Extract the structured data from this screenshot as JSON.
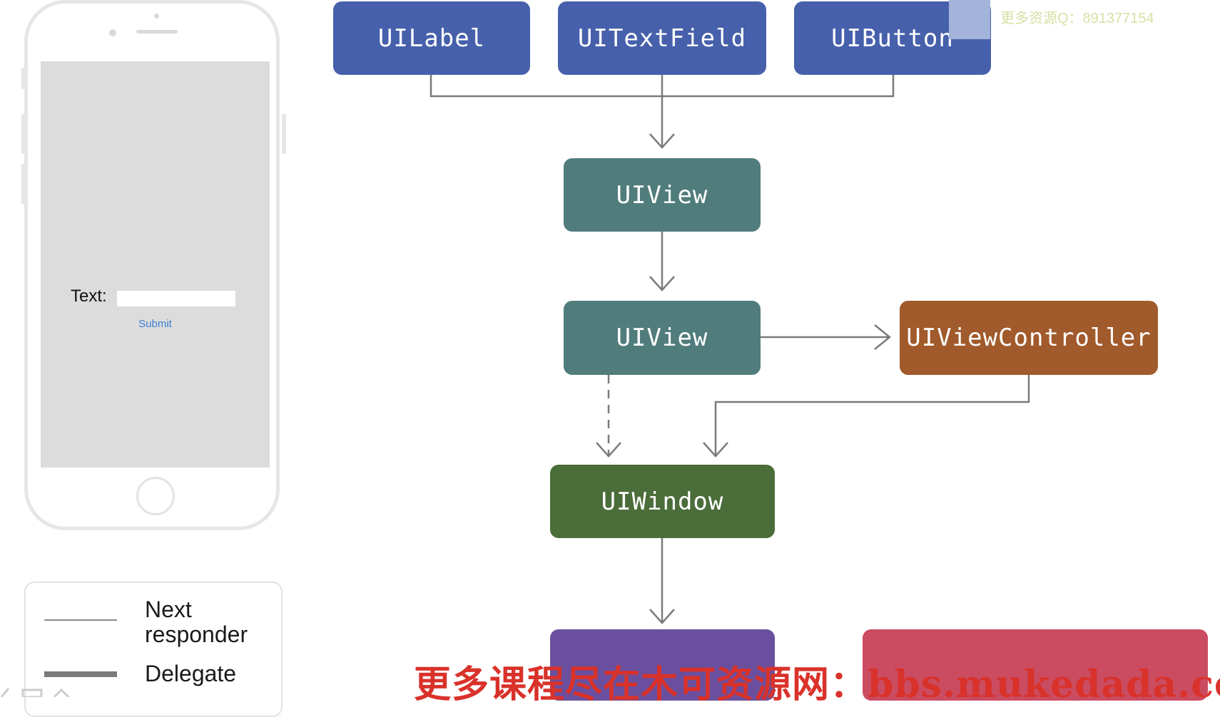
{
  "phone": {
    "text_label": "Text:",
    "submit_label": "Submit"
  },
  "legend": {
    "next_responder": "Next responder",
    "delegate": "Delegate"
  },
  "nodes": {
    "uilabel": "UILabel",
    "uitextfield": "UITextField",
    "uibutton": "UIButton",
    "uiview_child": "UIView",
    "uiview_root": "UIView",
    "uiviewcontroller": "UIViewController",
    "uiwindow": "UIWindow"
  },
  "watermark": {
    "qq": "更多资源Q：891377154",
    "banner": "更多课程尽在木可资源网：bbs.mukedada.com"
  },
  "colors": {
    "blue": "#4660ab",
    "teal": "#517c7c",
    "brown": "#a15a2b",
    "green": "#4b6d3a",
    "purple": "#6a4f9e",
    "red": "#cb4c61",
    "line": "#7a7a7a"
  }
}
